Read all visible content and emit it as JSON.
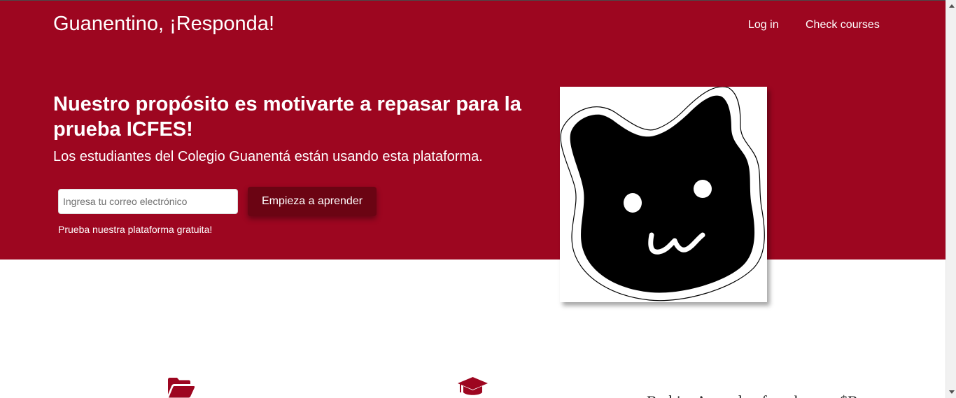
{
  "header": {
    "brand": "Guanentino, ¡Responda!",
    "nav": {
      "login": "Log in",
      "courses": "Check courses"
    }
  },
  "hero": {
    "headline": "Nuestro propósito es motivarte a repasar para la prueba ICFES!",
    "subheadline": "Los estudiantes del Colegio Guanentá están usando esta plataforma.",
    "email_placeholder": "Ingresa tu correo electrónico",
    "email_value": "",
    "cta_label": "Empieza a aprender",
    "free_note": "Prueba nuestra plataforma gratuita!"
  },
  "features": {
    "icons": [
      "folder-open-icon",
      "graduation-cap-icon"
    ],
    "partial_text": "Brebin: Agrend o: foranhances $B"
  },
  "colors": {
    "brand_red": "#9d0620",
    "button_dark_red": "#6b0413",
    "white": "#ffffff"
  }
}
